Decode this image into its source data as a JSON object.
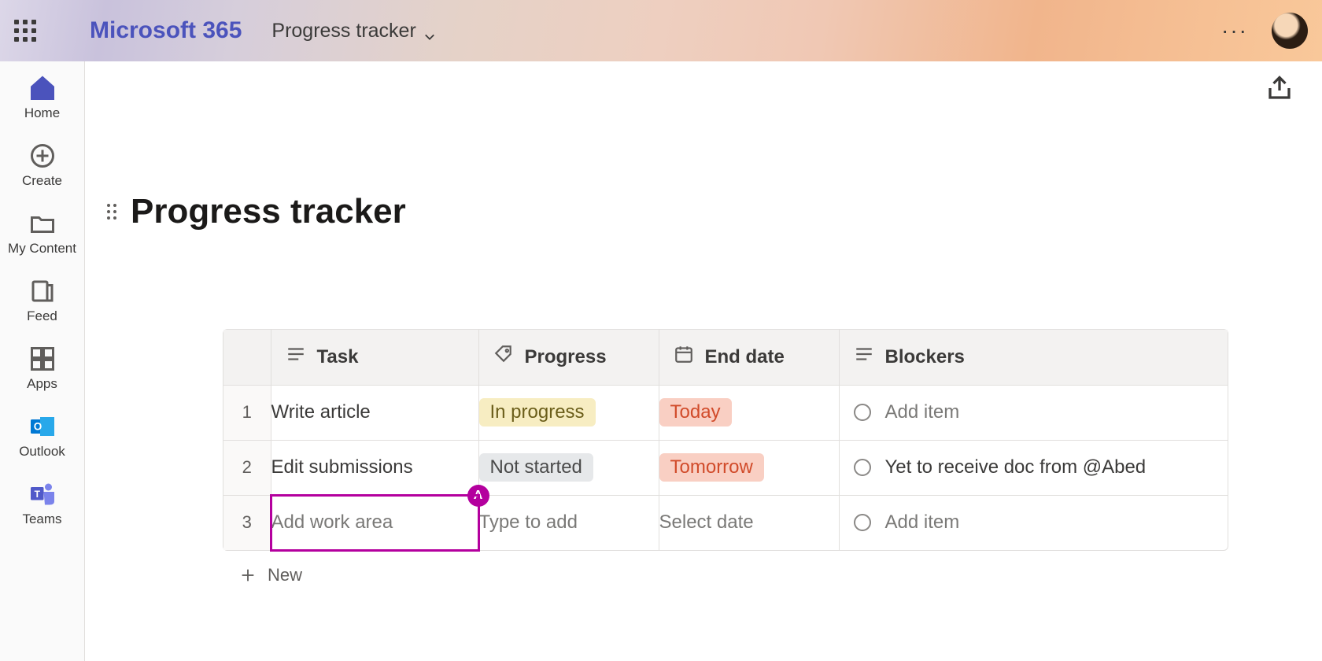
{
  "header": {
    "brand": "Microsoft 365",
    "doc_name": "Progress tracker"
  },
  "sidebar": {
    "items": [
      {
        "label": "Home"
      },
      {
        "label": "Create"
      },
      {
        "label": "My Content"
      },
      {
        "label": "Feed"
      },
      {
        "label": "Apps"
      },
      {
        "label": "Outlook"
      },
      {
        "label": "Teams"
      }
    ]
  },
  "page": {
    "title": "Progress tracker"
  },
  "table": {
    "columns": [
      {
        "label": "Task"
      },
      {
        "label": "Progress"
      },
      {
        "label": "End date"
      },
      {
        "label": "Blockers"
      }
    ],
    "rows": [
      {
        "num": "1",
        "task": "Write article",
        "progress": "In progress",
        "progress_style": "in",
        "end_date": "Today",
        "blocker": "Add item",
        "blocker_is_placeholder": true
      },
      {
        "num": "2",
        "task": "Edit submissions",
        "progress": "Not started",
        "progress_style": "not",
        "end_date": "Tomorrow",
        "blocker": "Yet to receive doc from @Abed",
        "blocker_is_placeholder": false
      },
      {
        "num": "3",
        "task": "Add work area",
        "task_editing": true,
        "presence_initial": "A",
        "progress": "Type to add",
        "progress_placeholder": true,
        "end_date": "Select date",
        "end_date_placeholder": true,
        "blocker": "Add item",
        "blocker_is_placeholder": true
      }
    ],
    "new_label": "New"
  }
}
